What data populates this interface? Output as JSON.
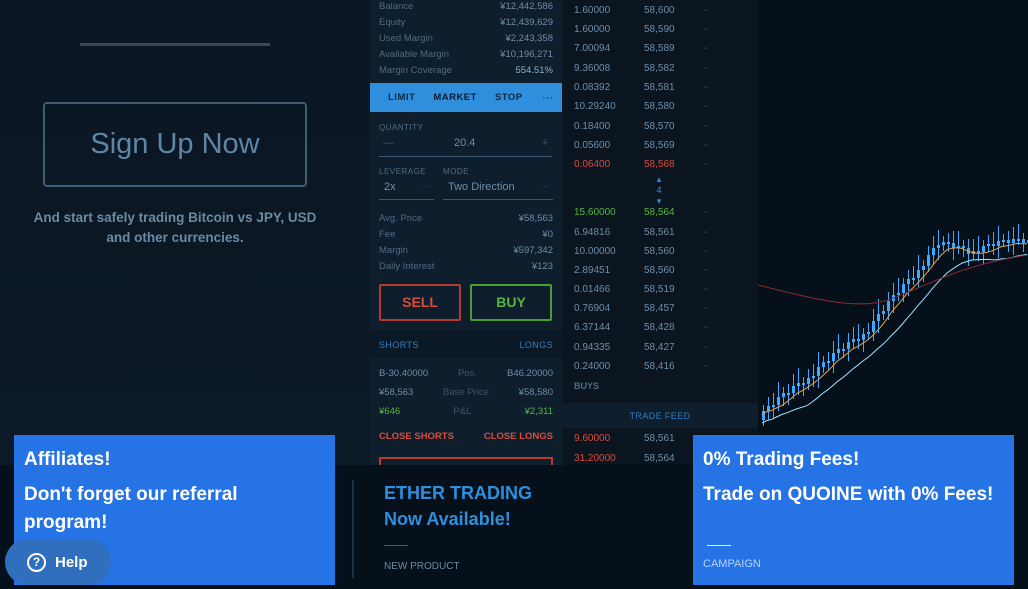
{
  "hero": {
    "signup_label": "Sign Up Now",
    "tagline": "And start safely trading Bitcoin vs JPY, USD and other currencies."
  },
  "account": [
    {
      "label": "Balance",
      "value": "¥12,442,586"
    },
    {
      "label": "Equity",
      "value": "¥12,439,629"
    },
    {
      "label": "Used Margin",
      "value": "¥2,243,358"
    },
    {
      "label": "Available Margin",
      "value": "¥10,196,271"
    },
    {
      "label": "Margin Coverage",
      "value": "554.51%"
    }
  ],
  "order_tabs": [
    "LIMIT",
    "MARKET",
    "STOP"
  ],
  "order_tabs_more": "···",
  "form": {
    "quantity_label": "QUANTITY",
    "quantity_minus": "—",
    "quantity_value": "20.4",
    "quantity_plus": "+",
    "leverage_label": "LEVERAGE",
    "leverage_value": "2x",
    "leverage_more": "···",
    "mode_label": "MODE",
    "mode_value": "Two Direction",
    "mode_more": "···"
  },
  "summary": [
    {
      "label": "Avg. Price",
      "value": "¥58,563"
    },
    {
      "label": "Fee",
      "value": "¥0"
    },
    {
      "label": "Margin",
      "value": "¥597,342"
    },
    {
      "label": "Daily Interest",
      "value": "¥123"
    }
  ],
  "actions": {
    "sell": "SELL",
    "buy": "BUY"
  },
  "positions": {
    "shorts_label": "SHORTS",
    "longs_label": "LONGS",
    "rows": [
      {
        "left": "B-30.40000",
        "mid": "Pos.",
        "right": "B46.20000"
      },
      {
        "left": "¥58,563",
        "mid": "Base Price",
        "right": "¥58,580"
      },
      {
        "left": "¥646",
        "mid": "P&L",
        "right": "¥2,311"
      }
    ],
    "close_shorts": "CLOSE SHORTS",
    "close_longs": "CLOSE LONGS"
  },
  "order_book": {
    "dash": "-",
    "rows": [
      {
        "amt": "1.60000",
        "px": "58,600",
        "side": ""
      },
      {
        "amt": "1.60000",
        "px": "58,590",
        "side": ""
      },
      {
        "amt": "7.00094",
        "px": "58,589",
        "side": ""
      },
      {
        "amt": "9.36008",
        "px": "58,582",
        "side": ""
      },
      {
        "amt": "0.08392",
        "px": "58,581",
        "side": ""
      },
      {
        "amt": "10.29240",
        "px": "58,580",
        "side": ""
      },
      {
        "amt": "0.18400",
        "px": "58,570",
        "side": ""
      },
      {
        "amt": "0.05600",
        "px": "58,569",
        "side": ""
      },
      {
        "amt": "0.06400",
        "px": "58,568",
        "side": "sell"
      },
      {
        "amt": "15.60000",
        "px": "58,564",
        "side": "buy"
      },
      {
        "amt": "6.94816",
        "px": "58,561",
        "side": ""
      },
      {
        "amt": "10.00000",
        "px": "58,560",
        "side": ""
      },
      {
        "amt": "2.89451",
        "px": "58,560",
        "side": ""
      },
      {
        "amt": "0.01466",
        "px": "58,519",
        "side": ""
      },
      {
        "amt": "0.76904",
        "px": "58,457",
        "side": ""
      },
      {
        "amt": "6.37144",
        "px": "58,428",
        "side": ""
      },
      {
        "amt": "0.94335",
        "px": "58,427",
        "side": ""
      },
      {
        "amt": "0.24000",
        "px": "58,416",
        "side": ""
      }
    ],
    "spread_value": "4",
    "buys_label": "BUYS",
    "trade_feed_label": "TRADE FEED",
    "feed_rows": [
      {
        "amt": "9.60000",
        "px": "58,561",
        "side": "sell"
      },
      {
        "amt": "31.20000",
        "px": "58,564",
        "side": "sell"
      }
    ]
  },
  "cards": {
    "affiliates": {
      "title": "Affiliates!",
      "body": "Don't forget our referral program!"
    },
    "ether": {
      "line1": "ETHER TRADING",
      "line2": "Now Available!",
      "tag": "NEW PRODUCT"
    },
    "fees": {
      "title": "0% Trading Fees!",
      "body": "Trade on QUOINE with 0% Fees!",
      "tag": "CAMPAIGN"
    }
  },
  "help": {
    "label": "Help",
    "icon_glyph": "?"
  },
  "colors": {
    "accent": "#2f8fdc",
    "card_blue": "#2673e6",
    "sell": "#d84c3c",
    "buy": "#56b63c",
    "candle": "#3da9ff"
  }
}
